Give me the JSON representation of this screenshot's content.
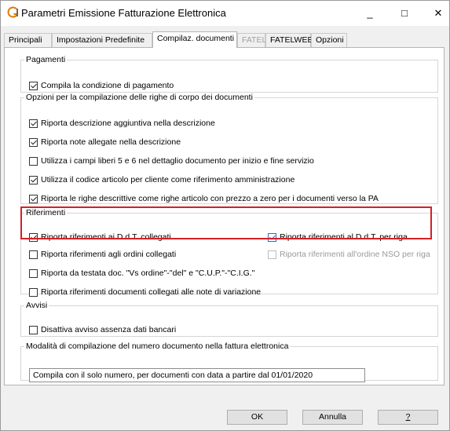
{
  "window": {
    "title": "Parametri Emissione Fatturazione Elettronica",
    "minimize": "_",
    "maximize": "□",
    "close": "✕"
  },
  "tabs": [
    {
      "label": "Principali",
      "state": "normal"
    },
    {
      "label": "Impostazioni Predefinite",
      "state": "normal"
    },
    {
      "label": "Compilaz. documenti",
      "state": "active"
    },
    {
      "label": "FATEL",
      "state": "disabled"
    },
    {
      "label": "FATELWEB",
      "state": "normal"
    },
    {
      "label": "Opzioni",
      "state": "normal"
    }
  ],
  "pagamenti": {
    "legend": "Pagamenti",
    "items": [
      {
        "label": "Compila la condizione di pagamento",
        "checked": true
      }
    ]
  },
  "opzioni_righe": {
    "legend": "Opzioni per la compilazione delle righe di corpo dei documenti",
    "items": [
      {
        "label": "Riporta descrizione aggiuntiva nella descrizione",
        "checked": true
      },
      {
        "label": "Riporta note allegate nella descrizione",
        "checked": true
      },
      {
        "label": "Utilizza i campi liberi 5 e 6 nel dettaglio documento per inizio e fine servizio",
        "checked": false
      },
      {
        "label": "Utilizza il codice articolo per cliente come riferimento amministrazione",
        "checked": true
      },
      {
        "label": "Riporta le righe descrittive come righe articolo con prezzo a zero per i documenti verso la PA",
        "checked": true
      }
    ]
  },
  "riferimenti": {
    "legend": "Riferimenti",
    "items": [
      {
        "label": "Riporta riferimenti ai D.d.T. collegati",
        "checked": true
      },
      {
        "label": "Riporta riferimenti al D.d.T. per riga",
        "checked": true
      },
      {
        "label": "Riporta riferimenti agli ordini collegati",
        "checked": false
      },
      {
        "label": "Riporta riferimenti all'ordine NSO per riga",
        "checked": false,
        "disabled": true
      },
      {
        "label": "Riporta da testata doc. \"Vs ordine\"-\"del\" e \"C.U.P.\"-\"C.I.G.\"",
        "checked": false
      },
      {
        "label": "Riporta riferimenti documenti collegati alle note di variazione",
        "checked": false
      }
    ]
  },
  "avvisi": {
    "legend": "Avvisi",
    "items": [
      {
        "label": "Disattiva avviso assenza dati bancari",
        "checked": false
      }
    ]
  },
  "modalita": {
    "legend": "Modalità di compilazione del numero documento nella fattura elettronica",
    "value": "Compila con il solo numero, per documenti con data a partire dal 01/01/2020"
  },
  "buttons": {
    "ok": "OK",
    "annulla": "Annulla",
    "help": "?"
  },
  "colors": {
    "highlight": "#d61f26",
    "checkbox_focus": "#1e6fd9",
    "app_icon": "#e07b00"
  }
}
